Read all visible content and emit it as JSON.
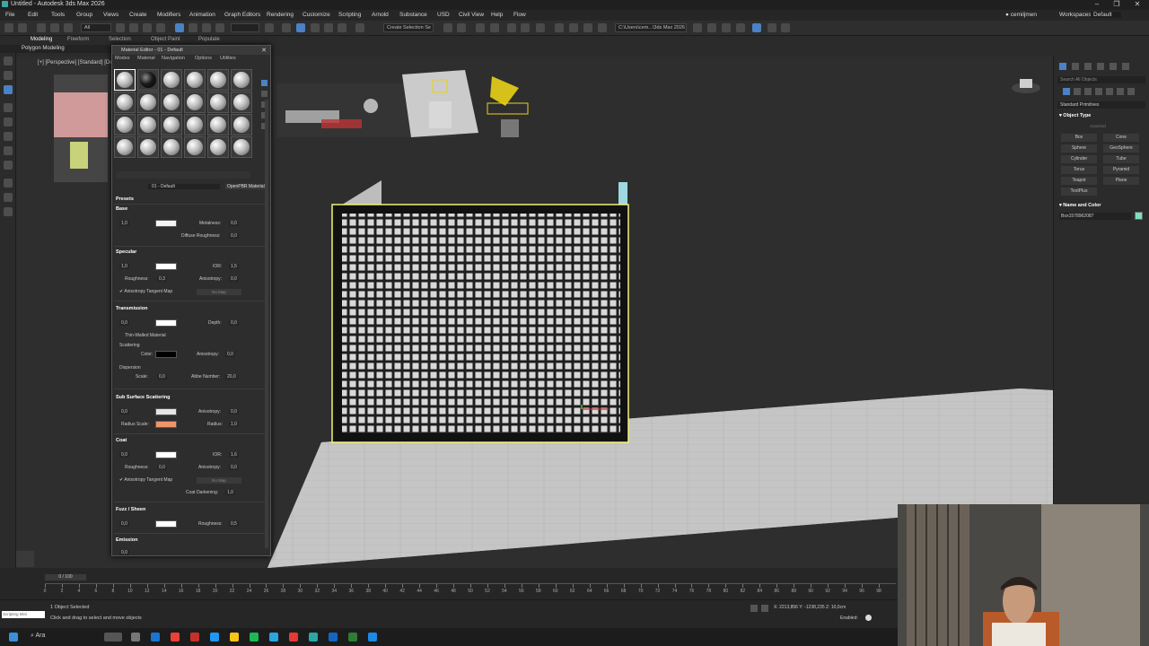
{
  "window": {
    "title": "Untitled - Autodesk 3ds Max 2026"
  },
  "menu": [
    "File",
    "Edit",
    "Tools",
    "Group",
    "Views",
    "Create",
    "Modifiers",
    "Animation",
    "Graph Editors",
    "Rendering",
    "Customize",
    "Scripting",
    "Arnold",
    "Substance",
    "USD",
    "Civil View",
    "Help",
    "Flow"
  ],
  "user": "cemiljmen",
  "workspace": {
    "label": "Workspaces:",
    "value": "Default"
  },
  "toolbar": {
    "filter": "All",
    "selection_set": "Create Selection Se",
    "path": "C:\\Users\\cem...\\3ds Max 2026"
  },
  "ribbon": {
    "tabs": [
      "Modeling",
      "Freeform",
      "Selection",
      "Object Paint",
      "Populate"
    ],
    "active_panel": "Polygon Modeling"
  },
  "viewport": {
    "label": "[+] [Perspective] [Standard] [Default Shading]"
  },
  "material_editor": {
    "title": "Material Editor - 01 - Default",
    "menus": [
      "Modes",
      "Material",
      "Navigation",
      "Options",
      "Utilities"
    ],
    "material_name": "01 - Default",
    "material_type": "OpenPBR Material",
    "sections": {
      "presets": "Presets",
      "base": {
        "title": "Base",
        "weight": "1,0",
        "metalness_label": "Metalness:",
        "metalness": "0,0",
        "diffuse_roughness_label": "Diffuse Roughness:",
        "diffuse_roughness": "0,0"
      },
      "specular": {
        "title": "Specular",
        "weight": "1,0",
        "ior_label": "IOR:",
        "ior": "1,5",
        "roughness_label": "Roughness:",
        "roughness": "0,3",
        "anisotropy_label": "Anisotropy:",
        "anisotropy": "0,0",
        "tangent": "Anisotropy Tangent Map",
        "nomap": "No Map"
      },
      "transmission": {
        "title": "Transmission",
        "weight": "0,0",
        "depth_label": "Depth:",
        "depth": "0,0",
        "thin_walled": "Thin-Walled Material",
        "scattering": "Scattering",
        "color_label": "Color:",
        "anisotropy_label": "Anisotropy:",
        "anisotropy": "0,0",
        "dispersion": "Dispersion",
        "scale_label": "Scale:",
        "scale": "0,0",
        "abbe_label": "Abbe Number:",
        "abbe": "20,0"
      },
      "sss": {
        "title": "Sub Surface Scattering",
        "weight": "0,0",
        "anisotropy_label": "Anisotropy:",
        "anisotropy": "0,0",
        "radius_scale_label": "Radius Scale:",
        "radius_label": "Radius:",
        "radius": "1,0"
      },
      "coat": {
        "title": "Coat",
        "weight": "0,0",
        "ior_label": "IOR:",
        "ior": "1,6",
        "roughness_label": "Roughness:",
        "roughness": "0,0",
        "anisotropy_label": "Anisotropy:",
        "anisotropy": "0,0",
        "tangent": "Anisotropy Tangent Map",
        "nomap": "No Map",
        "darkening_label": "Coat Darkening:",
        "darkening": "1,0"
      },
      "fuzz": {
        "title": "Fuzz / Sheen",
        "weight": "0,0",
        "roughness_label": "Roughness:",
        "roughness": "0,5"
      },
      "emission": {
        "title": "Emission",
        "weight": "0,0"
      }
    }
  },
  "command_panel": {
    "search": "Search All Objects",
    "category": "Standard Primitives",
    "object_type": "Object Type",
    "autogrid": "AutoGrid",
    "buttons": [
      "Box",
      "Cone",
      "Sphere",
      "GeoSphere",
      "Cylinder",
      "Tube",
      "Torus",
      "Pyramid",
      "Teapot",
      "Plane",
      "TextPlus"
    ],
    "name_color": "Name and Color",
    "object_name": "Box1578962087",
    "object_color": "#7fe0c0"
  },
  "timeline": {
    "slider": "0 / 100",
    "ticks": [
      "0",
      "2",
      "4",
      "6",
      "8",
      "10",
      "12",
      "14",
      "16",
      "18",
      "20",
      "22",
      "24",
      "26",
      "28",
      "30",
      "32",
      "34",
      "36",
      "38",
      "40",
      "42",
      "44",
      "46",
      "48",
      "50",
      "52",
      "54",
      "56",
      "58",
      "60",
      "62",
      "64",
      "66",
      "68",
      "70",
      "72",
      "74",
      "76",
      "78",
      "80",
      "82",
      "84",
      "86",
      "88",
      "90",
      "92",
      "94",
      "96",
      "98"
    ]
  },
  "status": {
    "script_label": "Scripting Mini",
    "selected": "1 Object Selected",
    "prompt": "Click and drag to select and move objects",
    "coords": "X: 2213,856   Y: -1238,235   Z: 10,0cm",
    "enabled": "Enabled:"
  },
  "taskbar": {
    "search": "Ara"
  }
}
